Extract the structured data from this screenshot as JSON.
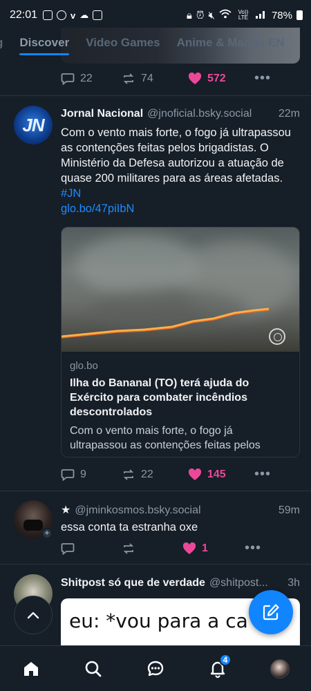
{
  "status_bar": {
    "time": "22:01",
    "left_icons": [
      "instagram-icon",
      "check-circle-icon",
      "v-icon",
      "cloud-icon",
      "gallery-icon"
    ],
    "right_icons": [
      "lock-icon",
      "alarm-icon",
      "mute-icon",
      "wifi-icon",
      "volte-icon",
      "signal-icon"
    ],
    "volte_label": "Vo)) LTE",
    "battery": "78%"
  },
  "tabs": [
    {
      "label": "g",
      "active": false
    },
    {
      "label": "Discover",
      "active": true
    },
    {
      "label": "Video Games",
      "active": false
    },
    {
      "label": "Anime & Manga EN",
      "active": false
    }
  ],
  "prev_post": {
    "replies": "22",
    "reposts": "74",
    "likes": "572"
  },
  "post1": {
    "author": "Jornal Nacional",
    "handle": "@jnoficial.bsky.social",
    "time": "22m",
    "avatar_text": "JN",
    "text": "Com o vento mais forte, o fogo já ultrapassou as contenções feitas pelos brigadistas. O Ministério da Defesa autorizou a atuação de quase 200 militares para as áreas afetadas. ",
    "hashtag": "#JN",
    "link": "glo.bo/47piIbN",
    "embed": {
      "domain": "glo.bo",
      "title": "Ilha do Bananal (TO) terá ajuda do Exército para combater incêndios descontrolados",
      "description": "Com o vento mais forte, o fogo já ultrapassou as contenções feitas pelos brigadistas..."
    },
    "replies": "9",
    "reposts": "22",
    "likes": "145"
  },
  "post2": {
    "star": "★",
    "handle": "@jminkosmos.bsky.social",
    "time": "59m",
    "text": "essa conta ta estranha oxe",
    "replies": "",
    "reposts": "",
    "likes": "1"
  },
  "post3": {
    "author": "Shitpost só que de verdade",
    "handle": "@shitpost...",
    "time": "3h",
    "meme_text": "eu: *vou para a ca"
  },
  "bottom_nav": {
    "notifications_badge": "4"
  },
  "colors": {
    "background": "#161e27",
    "accent": "#1185fe",
    "like": "#ec4899",
    "muted": "#8b98a5",
    "link": "#1e8cff"
  }
}
